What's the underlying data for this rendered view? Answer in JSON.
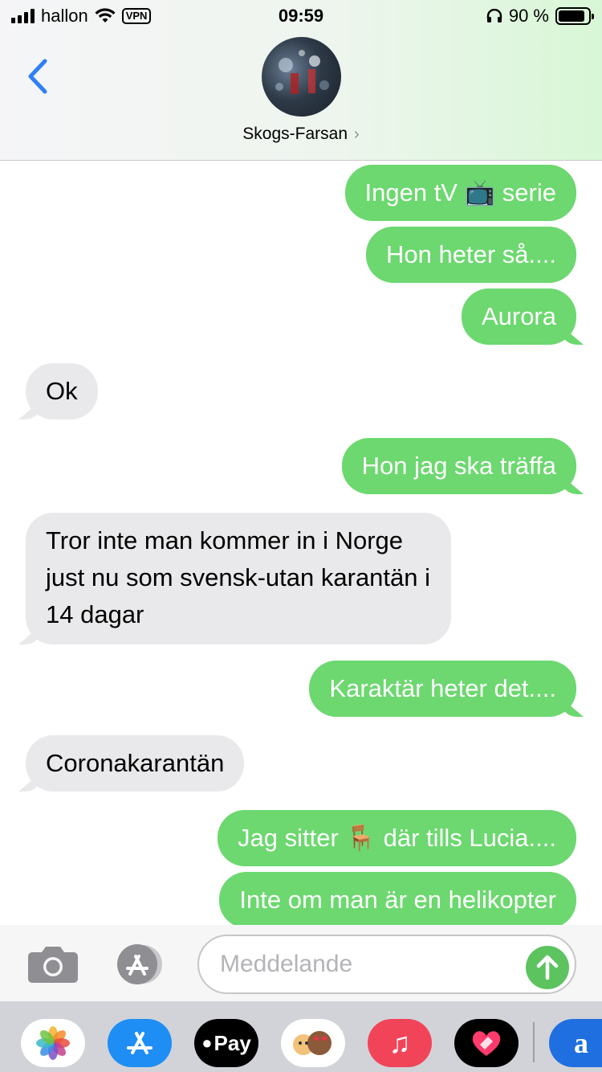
{
  "status": {
    "carrier": "hallon",
    "vpn": "VPN",
    "time": "09:59",
    "battery": "90 %",
    "battery_level": 0.9
  },
  "header": {
    "contact_name": "Skogs-Farsan",
    "chevron": "›"
  },
  "messages": [
    {
      "side": "out",
      "text": "Ingen tV 📺 serie"
    },
    {
      "side": "out",
      "text": "Hon heter så...."
    },
    {
      "side": "out",
      "text": "Aurora"
    },
    {
      "side": "in",
      "text": "Ok"
    },
    {
      "side": "out",
      "text": "Hon jag ska träffa"
    },
    {
      "side": "in",
      "text": "Tror inte man kommer in i Norge just nu som svensk-utan karantän i 14 dagar"
    },
    {
      "side": "out",
      "text": "Karaktär heter det...."
    },
    {
      "side": "in",
      "text": "Coronakarantän"
    },
    {
      "side": "out",
      "text": "Jag sitter 🪑 där tills Lucia...."
    },
    {
      "side": "out",
      "text": "Inte om man är en helikopter"
    }
  ],
  "composer": {
    "placeholder": "Meddelande"
  },
  "apps": [
    {
      "name": "photos-app-icon"
    },
    {
      "name": "app-store-app-icon"
    },
    {
      "name": "apple-pay-app-icon",
      "label": "Pay"
    },
    {
      "name": "memoji-app-icon"
    },
    {
      "name": "music-app-icon",
      "label": "♫"
    },
    {
      "name": "digital-touch-app-icon"
    },
    {
      "name": "amazon-app-icon",
      "label": "a"
    }
  ],
  "colors": {
    "outgoing": "#6cd86f",
    "incoming": "#e9e9eb",
    "accent": "#2f7ff6"
  }
}
